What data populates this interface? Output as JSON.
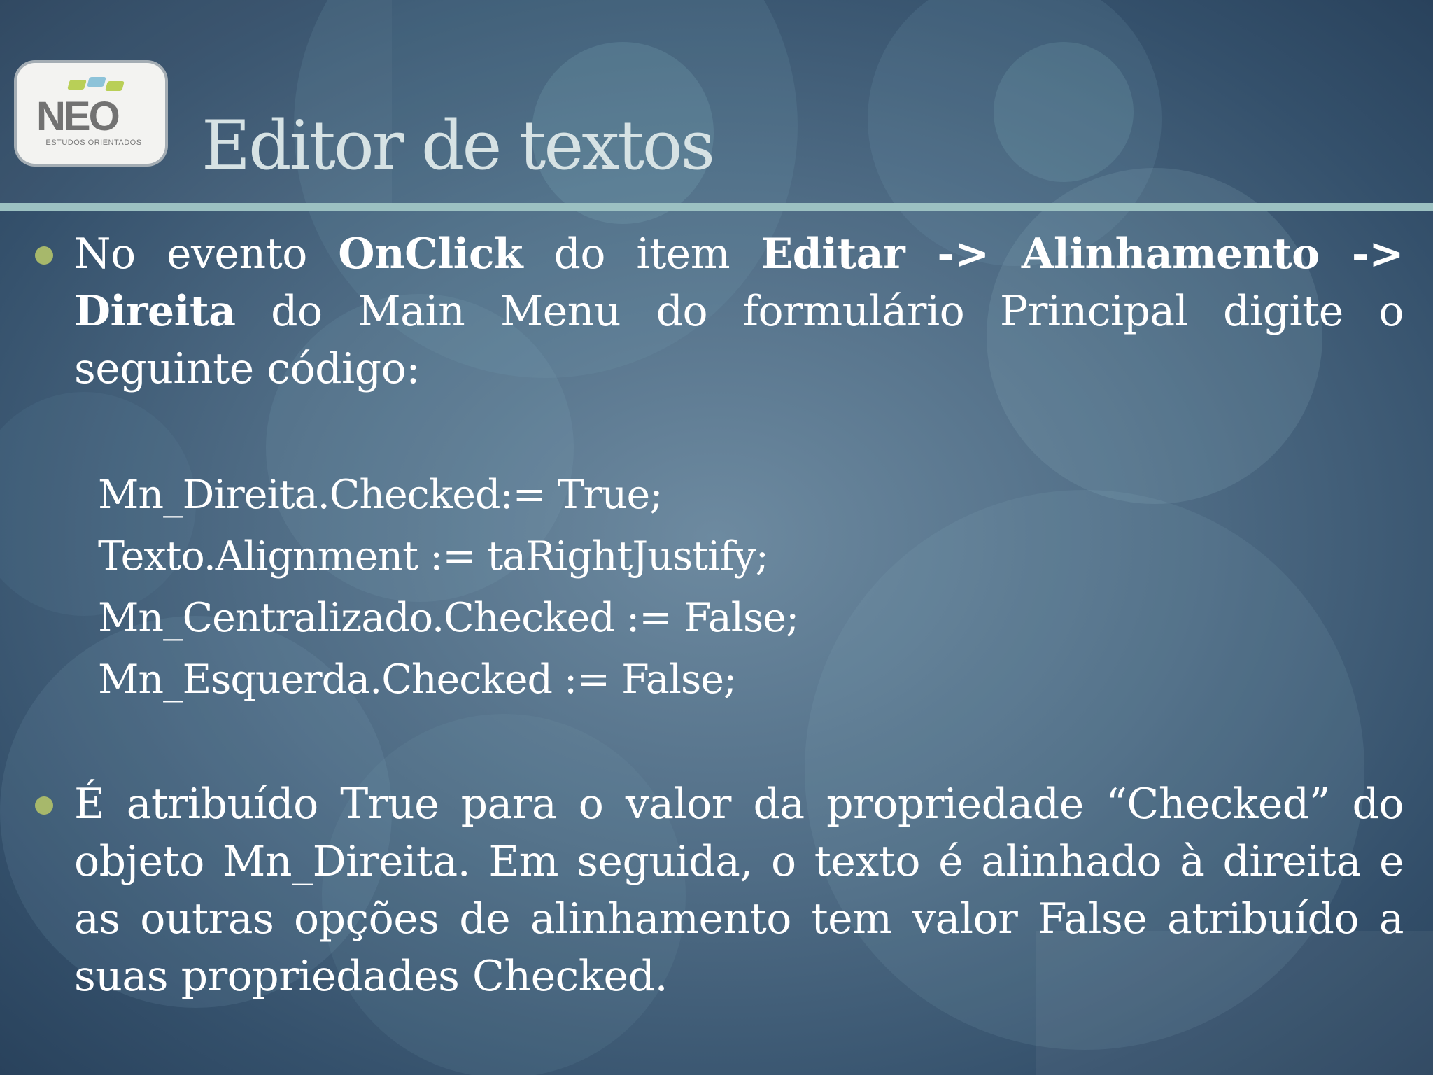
{
  "logo": {
    "word": "NEO",
    "subtitle": "ESTUDOS ORIENTADOS"
  },
  "slide": {
    "title": "Editor de textos",
    "bullet1": {
      "parts": [
        "No evento ",
        "OnClick",
        " do item ",
        "Editar -> Alinhamento -> Direita",
        " do Main Menu do formulário Principal digite o seguinte código:"
      ]
    },
    "code_lines": [
      "Mn_Direita.Checked:= True;",
      "Texto.Alignment := taRightJustify;",
      "Mn_Centralizado.Checked := False;",
      "Mn_Esquerda.Checked := False;"
    ],
    "bullet2": "É atribuído True para o valor da propriedade “Checked” do objeto Mn_Direita. Em seguida, o texto é alinhado à direita e as outras opções de alinhamento tem valor False atribuído a suas propriedades Checked."
  },
  "colors": {
    "background": "#4f6c85",
    "title_text": "#d6e2e4",
    "rule": "#9cc1c2",
    "bullet_dot": "#a7b86b",
    "body_text": "#ffffff"
  }
}
